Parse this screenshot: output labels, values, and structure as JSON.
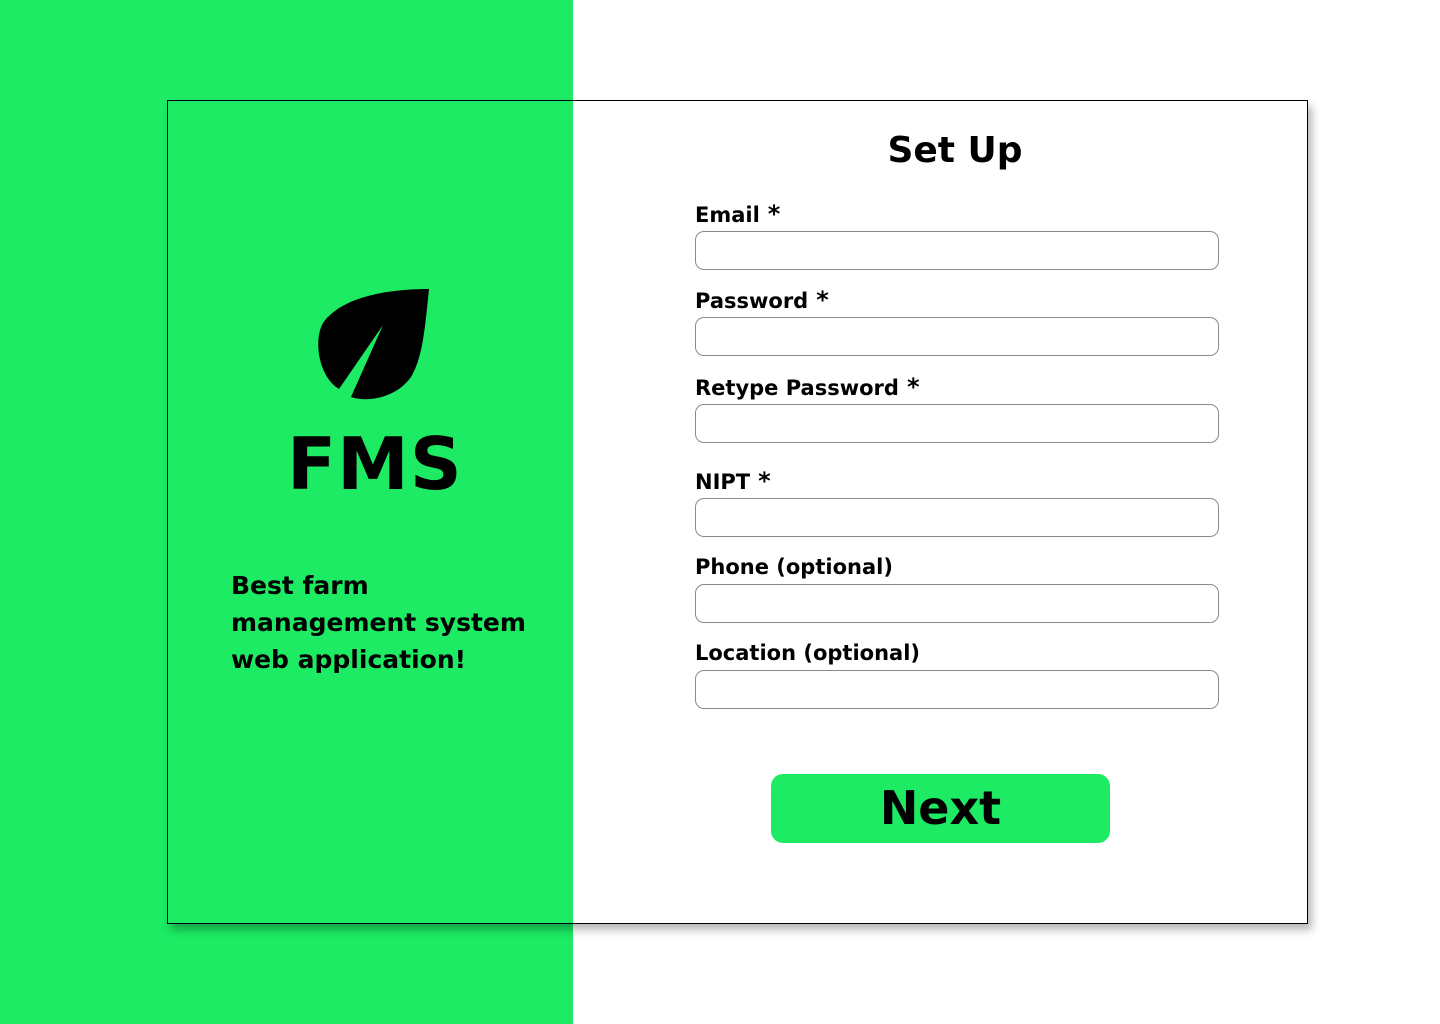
{
  "brand": {
    "logo_text": "FMS",
    "icon": "leaf-icon",
    "tagline": "Best farm management system web application!",
    "accent_color": "#1CEB63"
  },
  "form": {
    "title": "Set Up",
    "fields": [
      {
        "label": "Email",
        "required_marker": "*",
        "value": "",
        "placeholder": ""
      },
      {
        "label": "Password",
        "required_marker": "*",
        "value": "",
        "placeholder": ""
      },
      {
        "label": "Retype Password",
        "required_marker": "*",
        "value": "",
        "placeholder": ""
      },
      {
        "label": "NIPT",
        "required_marker": "*",
        "value": "",
        "placeholder": ""
      },
      {
        "label": "Phone (optional)",
        "value": "",
        "placeholder": ""
      },
      {
        "label": "Location (optional)",
        "value": "",
        "placeholder": ""
      }
    ],
    "next_label": "Next"
  }
}
